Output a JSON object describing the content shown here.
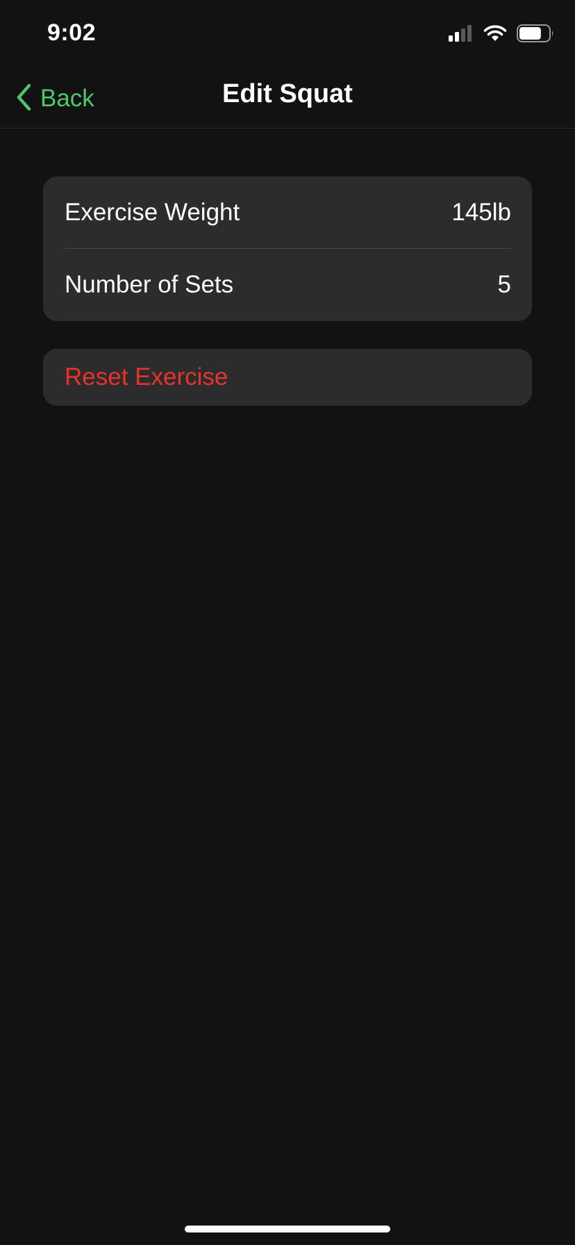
{
  "status_bar": {
    "time": "9:02",
    "icons": [
      "signal-icon",
      "wifi-icon",
      "battery-icon"
    ],
    "battery_level": 0.75
  },
  "nav": {
    "back_label": "Back",
    "title": "Edit Squat"
  },
  "settings": {
    "rows": [
      {
        "label": "Exercise Weight",
        "value": "145lb"
      },
      {
        "label": "Number of Sets",
        "value": "5"
      }
    ]
  },
  "reset": {
    "label": "Reset Exercise"
  },
  "colors": {
    "background": "#121212",
    "card": "#2c2c2e",
    "accent": "#4cc86a",
    "destructive": "#e7332a",
    "text": "#ffffff"
  }
}
